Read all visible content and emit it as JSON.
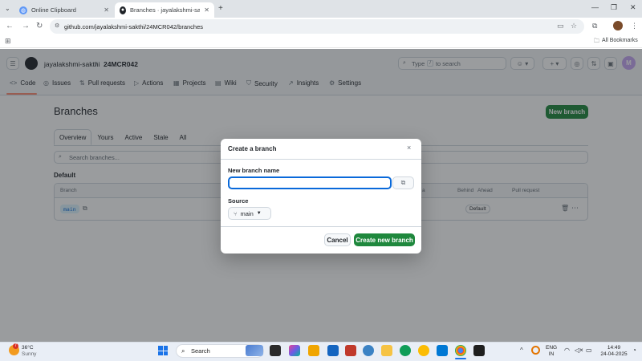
{
  "browser": {
    "tabs": [
      {
        "title": "Online Clipboard",
        "active": false
      },
      {
        "title": "Branches · jayalakshmi-sakthi/2·",
        "active": true
      }
    ],
    "url": "github.com/jayalakshmi-sakthi/24MCR042/branches",
    "all_bookmarks": "All Bookmarks",
    "profile_initial": "M"
  },
  "github": {
    "owner": "jayalakshmi-sakthi",
    "separator": "/",
    "repo": "24MCR042",
    "search_placeholder_a": "Type",
    "search_key": "/",
    "search_placeholder_b": "to search",
    "plus": "+",
    "nav": [
      {
        "label": "Code",
        "icon": "<>"
      },
      {
        "label": "Issues",
        "icon": "◎"
      },
      {
        "label": "Pull requests",
        "icon": "⇅"
      },
      {
        "label": "Actions",
        "icon": "▷"
      },
      {
        "label": "Projects",
        "icon": "▦"
      },
      {
        "label": "Wiki",
        "icon": "▤"
      },
      {
        "label": "Security",
        "icon": "⛉"
      },
      {
        "label": "Insights",
        "icon": "↗"
      },
      {
        "label": "Settings",
        "icon": "⚙"
      }
    ]
  },
  "page": {
    "title": "Branches",
    "new_branch": "New branch",
    "subnav": [
      "Overview",
      "Yours",
      "Active",
      "Stale",
      "All"
    ],
    "search_placeholder": "Search branches...",
    "section": "Default",
    "columns": {
      "branch": "Branch",
      "updated": "a",
      "behind": "Behind",
      "ahead": "Ahead",
      "pull_request": "Pull request"
    },
    "row": {
      "branch": "main",
      "badge": "Default"
    }
  },
  "dialog": {
    "title": "Create a branch",
    "close": "×",
    "name_label": "New branch name",
    "name_value": "",
    "source_label": "Source",
    "source_branch": "main",
    "cancel": "Cancel",
    "submit": "Create new branch"
  },
  "taskbar": {
    "temperature": "36°C",
    "weather": "Sunny",
    "search": "Search",
    "lang_a": "ENG",
    "lang_b": "IN",
    "time": "14:49",
    "date": "24-04-2025"
  },
  "colors": {
    "accent_green": "#1f883d",
    "focus_blue": "#0969da",
    "header_bg": "#f6f8fa"
  }
}
